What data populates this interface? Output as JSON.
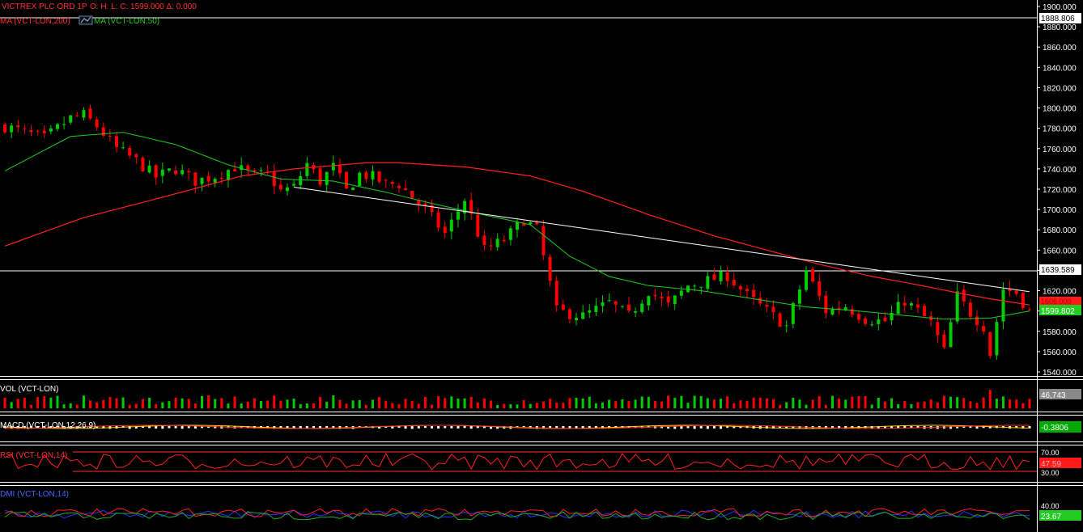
{
  "header": {
    "symbol": "VICTREX PLC ORD 1P",
    "ohlc": "O:     H:     L:     C: 1599.000   Δ: 0.000",
    "ma200_label": "MA (VCT-LON,200)",
    "ma50_label": "MA (VCT-LON,50)"
  },
  "colors": {
    "background": "#000000",
    "up": "#00cc00",
    "down": "#ff0000",
    "ma200": "#ff2020",
    "ma50": "#22cc22",
    "trendline": "#ffffff",
    "axis_text": "#ffffff",
    "title_text": "#ff3030"
  },
  "price_axis": {
    "ticks": [
      "1900.000",
      "1880.000",
      "1860.000",
      "1840.000",
      "1820.000",
      "1800.000",
      "1780.000",
      "1760.000",
      "1740.000",
      "1720.000",
      "1700.000",
      "1680.000",
      "1660.000",
      "1640.000",
      "1620.000",
      "1600.000",
      "1580.000",
      "1560.000",
      "1540.000"
    ],
    "marker_top": "1888.806",
    "marker_mid": "1639.589",
    "marker_ma200": "1606.000",
    "marker_ma50": "1599.802"
  },
  "volume": {
    "label": "VOL (VCT-LON)",
    "value": "46,743"
  },
  "macd": {
    "label": "MACD (VCT-LON,12,26,9)",
    "value": "-0.3806"
  },
  "rsi": {
    "label": "RSI (VCT-LON,14)",
    "value": "47.59",
    "ticks": [
      "70.00",
      "30.00"
    ]
  },
  "dmi": {
    "label": "DMI (VCT-LON,14)",
    "value": "23.67",
    "ticks": [
      "40.00"
    ]
  },
  "chart_data": {
    "type": "candlestick",
    "ylim": [
      1538,
      1905
    ],
    "horizontal_lines": [
      1888.806,
      1639.589
    ],
    "trendline": [
      [
        44,
        1722
      ],
      [
        156,
        1619
      ]
    ],
    "n_bars": 157,
    "close_anchors": [
      [
        0,
        1782
      ],
      [
        6,
        1770
      ],
      [
        10,
        1790
      ],
      [
        12,
        1793
      ],
      [
        14,
        1782
      ],
      [
        17,
        1760
      ],
      [
        20,
        1748
      ],
      [
        23,
        1732
      ],
      [
        26,
        1740
      ],
      [
        29,
        1728
      ],
      [
        32,
        1733
      ],
      [
        35,
        1742
      ],
      [
        38,
        1733
      ],
      [
        40,
        1735
      ],
      [
        42,
        1718
      ],
      [
        44,
        1722
      ],
      [
        46,
        1745
      ],
      [
        48,
        1728
      ],
      [
        50,
        1742
      ],
      [
        52,
        1718
      ],
      [
        54,
        1735
      ],
      [
        56,
        1732
      ],
      [
        58,
        1725
      ],
      [
        60,
        1725
      ],
      [
        62,
        1712
      ],
      [
        64,
        1700
      ],
      [
        67,
        1676
      ],
      [
        70,
        1710
      ],
      [
        73,
        1660
      ],
      [
        76,
        1670
      ],
      [
        79,
        1690
      ],
      [
        81,
        1680
      ],
      [
        84,
        1600
      ],
      [
        88,
        1595
      ],
      [
        92,
        1608
      ],
      [
        95,
        1595
      ],
      [
        98,
        1620
      ],
      [
        101,
        1605
      ],
      [
        104,
        1625
      ],
      [
        107,
        1630
      ],
      [
        110,
        1635
      ],
      [
        113,
        1615
      ],
      [
        116,
        1600
      ],
      [
        119,
        1585
      ],
      [
        122,
        1640
      ],
      [
        125,
        1600
      ],
      [
        128,
        1605
      ],
      [
        131,
        1592
      ],
      [
        134,
        1590
      ],
      [
        137,
        1610
      ],
      [
        139,
        1600
      ],
      [
        141,
        1588
      ],
      [
        143,
        1560
      ],
      [
        145,
        1615
      ],
      [
        147,
        1598
      ],
      [
        149,
        1585
      ],
      [
        150,
        1558
      ],
      [
        152,
        1622
      ],
      [
        154,
        1618
      ],
      [
        156,
        1599
      ]
    ],
    "ma50_anchors": [
      [
        0,
        1738
      ],
      [
        10,
        1772
      ],
      [
        18,
        1776
      ],
      [
        26,
        1764
      ],
      [
        34,
        1744
      ],
      [
        42,
        1730
      ],
      [
        50,
        1728
      ],
      [
        58,
        1717
      ],
      [
        65,
        1706
      ],
      [
        72,
        1696
      ],
      [
        80,
        1685
      ],
      [
        86,
        1654
      ],
      [
        92,
        1634
      ],
      [
        98,
        1625
      ],
      [
        106,
        1620
      ],
      [
        114,
        1612
      ],
      [
        122,
        1604
      ],
      [
        130,
        1600
      ],
      [
        138,
        1595
      ],
      [
        143,
        1592
      ],
      [
        150,
        1593
      ],
      [
        156,
        1600
      ]
    ],
    "ma200_anchors": [
      [
        0,
        1664
      ],
      [
        12,
        1692
      ],
      [
        24,
        1712
      ],
      [
        36,
        1733
      ],
      [
        44,
        1740
      ],
      [
        55,
        1746
      ],
      [
        60,
        1746
      ],
      [
        70,
        1742
      ],
      [
        80,
        1733
      ],
      [
        88,
        1718
      ],
      [
        98,
        1695
      ],
      [
        108,
        1674
      ],
      [
        116,
        1660
      ],
      [
        124,
        1646
      ],
      [
        132,
        1634
      ],
      [
        138,
        1627
      ],
      [
        145,
        1618
      ],
      [
        150,
        1612
      ],
      [
        156,
        1606
      ]
    ]
  }
}
